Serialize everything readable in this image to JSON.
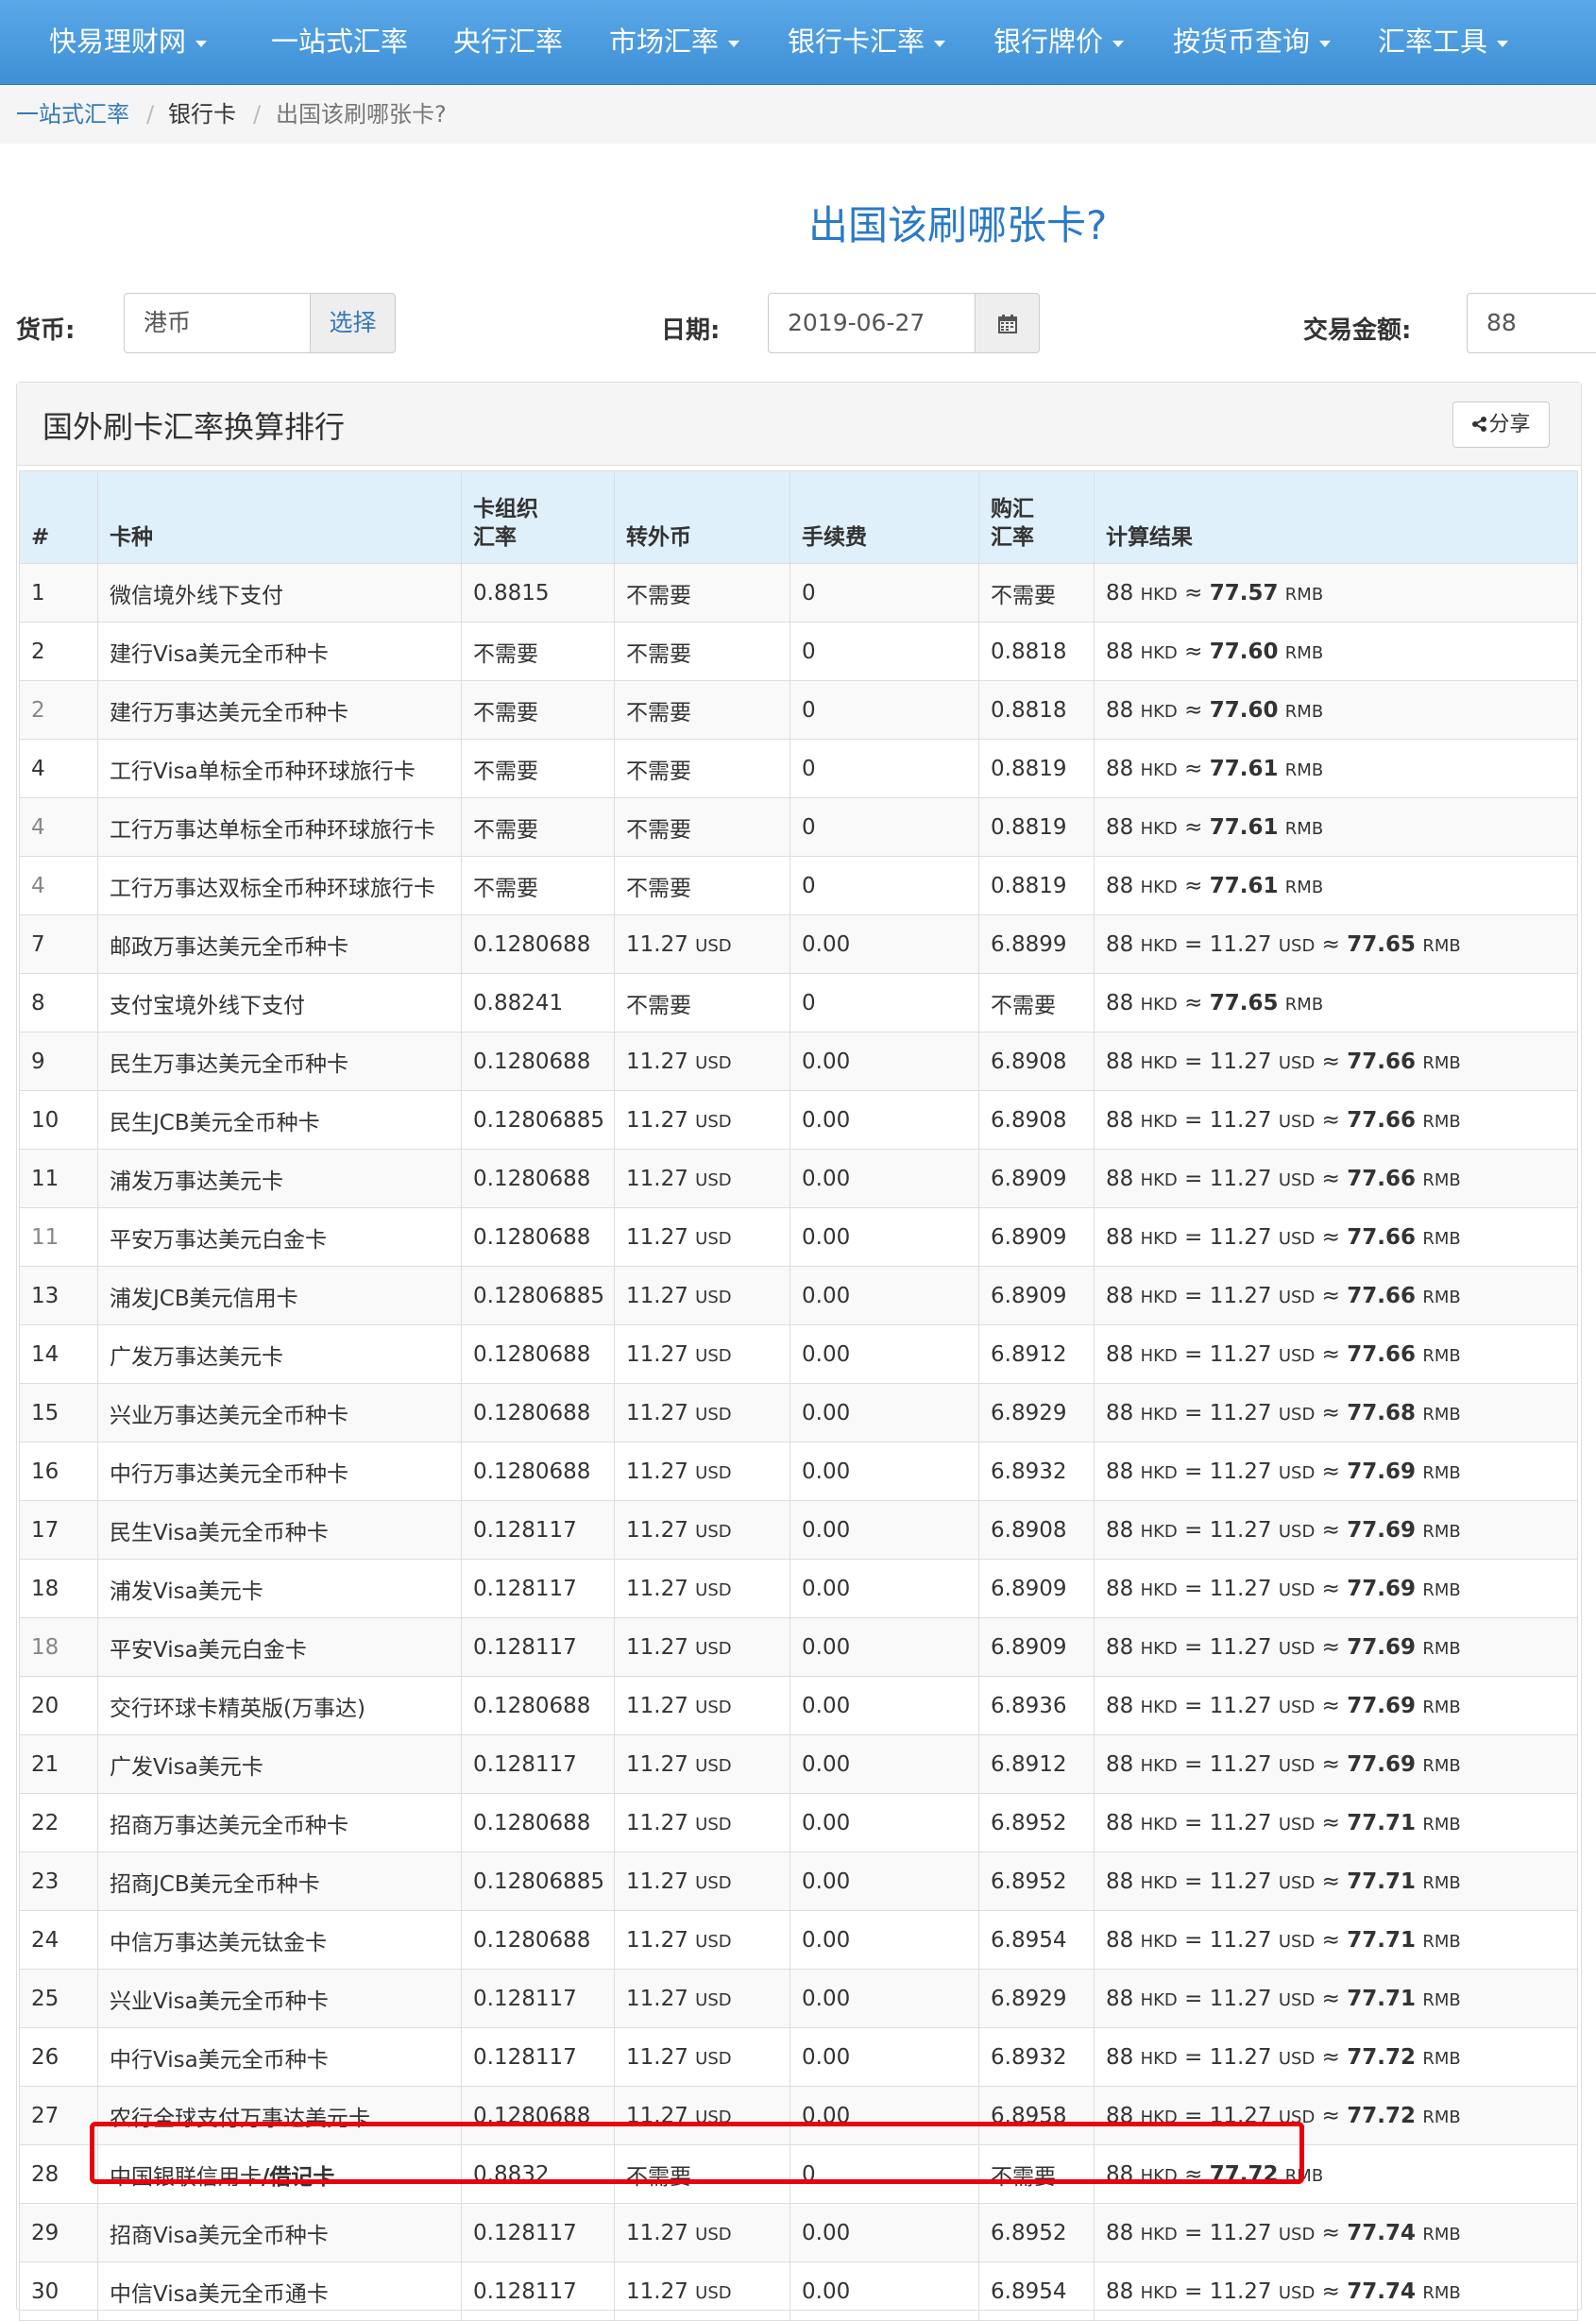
{
  "nav": {
    "items": [
      {
        "label": "快易理财网",
        "dropdown": true
      },
      {
        "label": "一站式汇率",
        "dropdown": false
      },
      {
        "label": "央行汇率",
        "dropdown": false
      },
      {
        "label": "市场汇率",
        "dropdown": true
      },
      {
        "label": "银行卡汇率",
        "dropdown": true
      },
      {
        "label": "银行牌价",
        "dropdown": true
      },
      {
        "label": "按货币查询",
        "dropdown": true
      },
      {
        "label": "汇率工具",
        "dropdown": true
      }
    ]
  },
  "breadcrumb": {
    "home": "一站式汇率",
    "section": "银行卡",
    "current": "出国该刷哪张卡?"
  },
  "title": "出国该刷哪张卡?",
  "form": {
    "currency_label": "货币:",
    "currency_value": "港币",
    "select_label": "选择",
    "date_label": "日期:",
    "date_value": "2019-06-27",
    "amount_label": "交易金额:",
    "amount_value": "88"
  },
  "panel": {
    "title": "国外刷卡汇率换算排行",
    "share_label": "分享"
  },
  "table": {
    "headers": {
      "rank": "#",
      "card": "卡种",
      "org_rate_1": "卡组织",
      "org_rate_2": "汇率",
      "convert": "转外币",
      "fee": "手续费",
      "buy_rate_1": "购汇",
      "buy_rate_2": "汇率",
      "result": "计算结果"
    },
    "rows": [
      {
        "rank": "1",
        "card": "微信境外线下支付",
        "org": "0.8815",
        "conv": "不需要",
        "fee": "0",
        "buy": "不需要",
        "result": {
          "amt": "88",
          "cur": "HKD",
          "usd": "",
          "rmb": "77.57"
        }
      },
      {
        "rank": "2",
        "card": "建行Visa美元全币种卡",
        "org": "不需要",
        "conv": "不需要",
        "fee": "0",
        "buy": "0.8818",
        "result": {
          "amt": "88",
          "cur": "HKD",
          "usd": "",
          "rmb": "77.60"
        }
      },
      {
        "rank": "2",
        "card": "建行万事达美元全币种卡",
        "org": "不需要",
        "conv": "不需要",
        "fee": "0",
        "buy": "0.8818",
        "result": {
          "amt": "88",
          "cur": "HKD",
          "usd": "",
          "rmb": "77.60"
        }
      },
      {
        "rank": "4",
        "card": "工行Visa单标全币种环球旅行卡",
        "org": "不需要",
        "conv": "不需要",
        "fee": "0",
        "buy": "0.8819",
        "result": {
          "amt": "88",
          "cur": "HKD",
          "usd": "",
          "rmb": "77.61"
        }
      },
      {
        "rank": "4",
        "card": "工行万事达单标全币种环球旅行卡",
        "org": "不需要",
        "conv": "不需要",
        "fee": "0",
        "buy": "0.8819",
        "result": {
          "amt": "88",
          "cur": "HKD",
          "usd": "",
          "rmb": "77.61"
        }
      },
      {
        "rank": "4",
        "card": "工行万事达双标全币种环球旅行卡",
        "org": "不需要",
        "conv": "不需要",
        "fee": "0",
        "buy": "0.8819",
        "result": {
          "amt": "88",
          "cur": "HKD",
          "usd": "",
          "rmb": "77.61"
        }
      },
      {
        "rank": "7",
        "card": "邮政万事达美元全币种卡",
        "org": "0.1280688",
        "conv": "11.27",
        "fee": "0.00",
        "buy": "6.8899",
        "result": {
          "amt": "88",
          "cur": "HKD",
          "usd": "11.27",
          "rmb": "77.65"
        }
      },
      {
        "rank": "8",
        "card": "支付宝境外线下支付",
        "org": "0.88241",
        "conv": "不需要",
        "fee": "0",
        "buy": "不需要",
        "result": {
          "amt": "88",
          "cur": "HKD",
          "usd": "",
          "rmb": "77.65"
        }
      },
      {
        "rank": "9",
        "card": "民生万事达美元全币种卡",
        "org": "0.1280688",
        "conv": "11.27",
        "fee": "0.00",
        "buy": "6.8908",
        "result": {
          "amt": "88",
          "cur": "HKD",
          "usd": "11.27",
          "rmb": "77.66"
        }
      },
      {
        "rank": "10",
        "card": "民生JCB美元全币种卡",
        "org": "0.12806885",
        "conv": "11.27",
        "fee": "0.00",
        "buy": "6.8908",
        "result": {
          "amt": "88",
          "cur": "HKD",
          "usd": "11.27",
          "rmb": "77.66"
        }
      },
      {
        "rank": "11",
        "card": "浦发万事达美元卡",
        "org": "0.1280688",
        "conv": "11.27",
        "fee": "0.00",
        "buy": "6.8909",
        "result": {
          "amt": "88",
          "cur": "HKD",
          "usd": "11.27",
          "rmb": "77.66"
        }
      },
      {
        "rank": "11",
        "card": "平安万事达美元白金卡",
        "org": "0.1280688",
        "conv": "11.27",
        "fee": "0.00",
        "buy": "6.8909",
        "result": {
          "amt": "88",
          "cur": "HKD",
          "usd": "11.27",
          "rmb": "77.66"
        }
      },
      {
        "rank": "13",
        "card": "浦发JCB美元信用卡",
        "org": "0.12806885",
        "conv": "11.27",
        "fee": "0.00",
        "buy": "6.8909",
        "result": {
          "amt": "88",
          "cur": "HKD",
          "usd": "11.27",
          "rmb": "77.66"
        }
      },
      {
        "rank": "14",
        "card": "广发万事达美元卡",
        "org": "0.1280688",
        "conv": "11.27",
        "fee": "0.00",
        "buy": "6.8912",
        "result": {
          "amt": "88",
          "cur": "HKD",
          "usd": "11.27",
          "rmb": "77.66"
        }
      },
      {
        "rank": "15",
        "card": "兴业万事达美元全币种卡",
        "org": "0.1280688",
        "conv": "11.27",
        "fee": "0.00",
        "buy": "6.8929",
        "result": {
          "amt": "88",
          "cur": "HKD",
          "usd": "11.27",
          "rmb": "77.68"
        }
      },
      {
        "rank": "16",
        "card": "中行万事达美元全币种卡",
        "org": "0.1280688",
        "conv": "11.27",
        "fee": "0.00",
        "buy": "6.8932",
        "result": {
          "amt": "88",
          "cur": "HKD",
          "usd": "11.27",
          "rmb": "77.69"
        }
      },
      {
        "rank": "17",
        "card": "民生Visa美元全币种卡",
        "org": "0.128117",
        "conv": "11.27",
        "fee": "0.00",
        "buy": "6.8908",
        "result": {
          "amt": "88",
          "cur": "HKD",
          "usd": "11.27",
          "rmb": "77.69"
        }
      },
      {
        "rank": "18",
        "card": "浦发Visa美元卡",
        "org": "0.128117",
        "conv": "11.27",
        "fee": "0.00",
        "buy": "6.8909",
        "result": {
          "amt": "88",
          "cur": "HKD",
          "usd": "11.27",
          "rmb": "77.69"
        }
      },
      {
        "rank": "18",
        "card": "平安Visa美元白金卡",
        "org": "0.128117",
        "conv": "11.27",
        "fee": "0.00",
        "buy": "6.8909",
        "result": {
          "amt": "88",
          "cur": "HKD",
          "usd": "11.27",
          "rmb": "77.69"
        }
      },
      {
        "rank": "20",
        "card": "交行环球卡精英版(万事达)",
        "org": "0.1280688",
        "conv": "11.27",
        "fee": "0.00",
        "buy": "6.8936",
        "result": {
          "amt": "88",
          "cur": "HKD",
          "usd": "11.27",
          "rmb": "77.69"
        }
      },
      {
        "rank": "21",
        "card": "广发Visa美元卡",
        "org": "0.128117",
        "conv": "11.27",
        "fee": "0.00",
        "buy": "6.8912",
        "result": {
          "amt": "88",
          "cur": "HKD",
          "usd": "11.27",
          "rmb": "77.69"
        }
      },
      {
        "rank": "22",
        "card": "招商万事达美元全币种卡",
        "org": "0.1280688",
        "conv": "11.27",
        "fee": "0.00",
        "buy": "6.8952",
        "result": {
          "amt": "88",
          "cur": "HKD",
          "usd": "11.27",
          "rmb": "77.71"
        }
      },
      {
        "rank": "23",
        "card": "招商JCB美元全币种卡",
        "org": "0.12806885",
        "conv": "11.27",
        "fee": "0.00",
        "buy": "6.8952",
        "result": {
          "amt": "88",
          "cur": "HKD",
          "usd": "11.27",
          "rmb": "77.71"
        }
      },
      {
        "rank": "24",
        "card": "中信万事达美元钛金卡",
        "org": "0.1280688",
        "conv": "11.27",
        "fee": "0.00",
        "buy": "6.8954",
        "result": {
          "amt": "88",
          "cur": "HKD",
          "usd": "11.27",
          "rmb": "77.71"
        }
      },
      {
        "rank": "25",
        "card": "兴业Visa美元全币种卡",
        "org": "0.128117",
        "conv": "11.27",
        "fee": "0.00",
        "buy": "6.8929",
        "result": {
          "amt": "88",
          "cur": "HKD",
          "usd": "11.27",
          "rmb": "77.71"
        }
      },
      {
        "rank": "26",
        "card": "中行Visa美元全币种卡",
        "org": "0.128117",
        "conv": "11.27",
        "fee": "0.00",
        "buy": "6.8932",
        "result": {
          "amt": "88",
          "cur": "HKD",
          "usd": "11.27",
          "rmb": "77.72"
        }
      },
      {
        "rank": "27",
        "card": "农行全球支付万事达美元卡",
        "org": "0.1280688",
        "conv": "11.27",
        "fee": "0.00",
        "buy": "6.8958",
        "result": {
          "amt": "88",
          "cur": "HKD",
          "usd": "11.27",
          "rmb": "77.72"
        }
      },
      {
        "rank": "28",
        "card": "中国银联信用卡/借记卡",
        "org": "0.8832",
        "conv": "不需要",
        "fee": "0",
        "buy": "不需要",
        "result": {
          "amt": "88",
          "cur": "HKD",
          "usd": "",
          "rmb": "77.72"
        }
      },
      {
        "rank": "29",
        "card": "招商Visa美元全币种卡",
        "org": "0.128117",
        "conv": "11.27",
        "fee": "0.00",
        "buy": "6.8952",
        "result": {
          "amt": "88",
          "cur": "HKD",
          "usd": "11.27",
          "rmb": "77.74"
        }
      },
      {
        "rank": "30",
        "card": "中信Visa美元全币通卡",
        "org": "0.128117",
        "conv": "11.27",
        "fee": "0.00",
        "buy": "6.8954",
        "result": {
          "amt": "88",
          "cur": "HKD",
          "usd": "11.27",
          "rmb": "77.74"
        }
      }
    ],
    "units": {
      "usd": "USD",
      "rmb": "RMB"
    },
    "highlighted_rank": "28"
  },
  "colors": {
    "nav_bg": "#4a9be0",
    "accent": "#2a7ac7",
    "highlight": "#e8000b",
    "header_bg": "#dff0fb"
  }
}
